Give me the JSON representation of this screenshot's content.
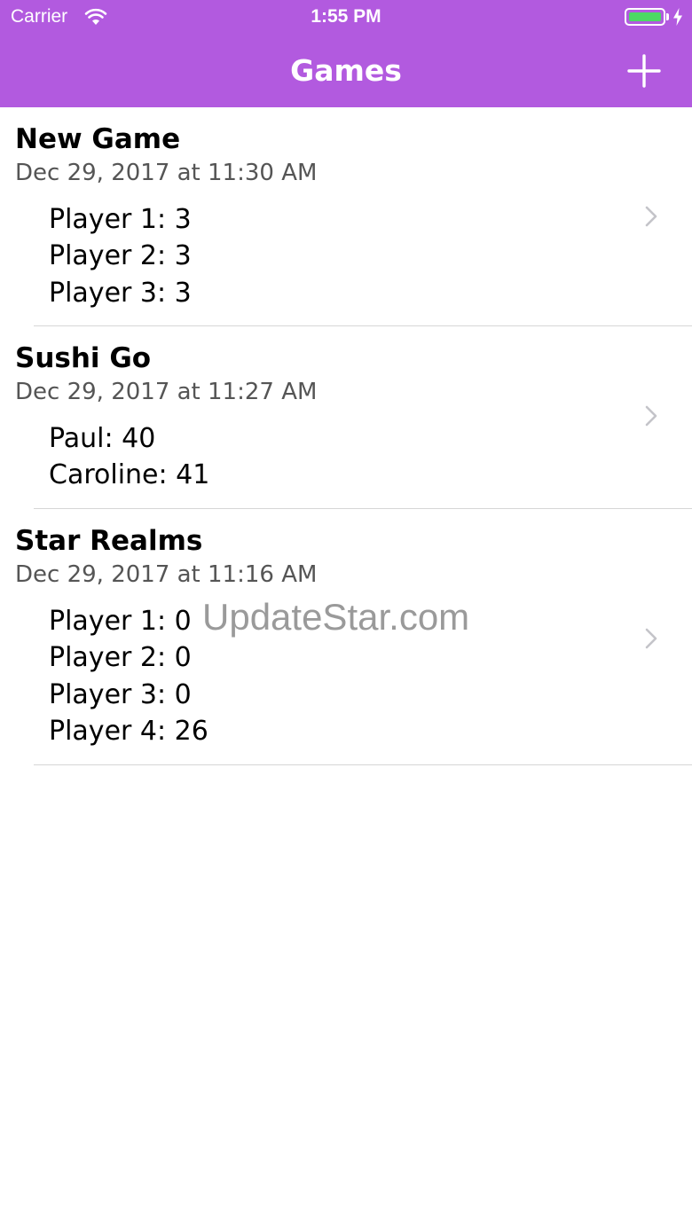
{
  "status_bar": {
    "carrier": "Carrier",
    "time": "1:55 PM",
    "battery_level": 1.0
  },
  "nav": {
    "title": "Games",
    "add_icon": "plus-icon"
  },
  "games": [
    {
      "title": "New Game",
      "date": "Dec 29, 2017 at 11:30 AM",
      "players": [
        "Player 1: 3",
        "Player 2: 3",
        "Player 3: 3"
      ]
    },
    {
      "title": "Sushi Go",
      "date": "Dec 29, 2017 at 11:27 AM",
      "players": [
        "Paul: 40",
        "Caroline: 41"
      ]
    },
    {
      "title": "Star Realms",
      "date": "Dec 29, 2017 at 11:16 AM",
      "players": [
        "Player 1: 0",
        "Player 2: 0",
        "Player 3: 0",
        "Player 4: 26"
      ]
    }
  ],
  "watermark": "UpdateStar.com",
  "colors": {
    "nav_background": "#b25adf",
    "battery": "#4cd964",
    "separator": "#d6d6d6",
    "chevron": "#c4c4c9"
  }
}
